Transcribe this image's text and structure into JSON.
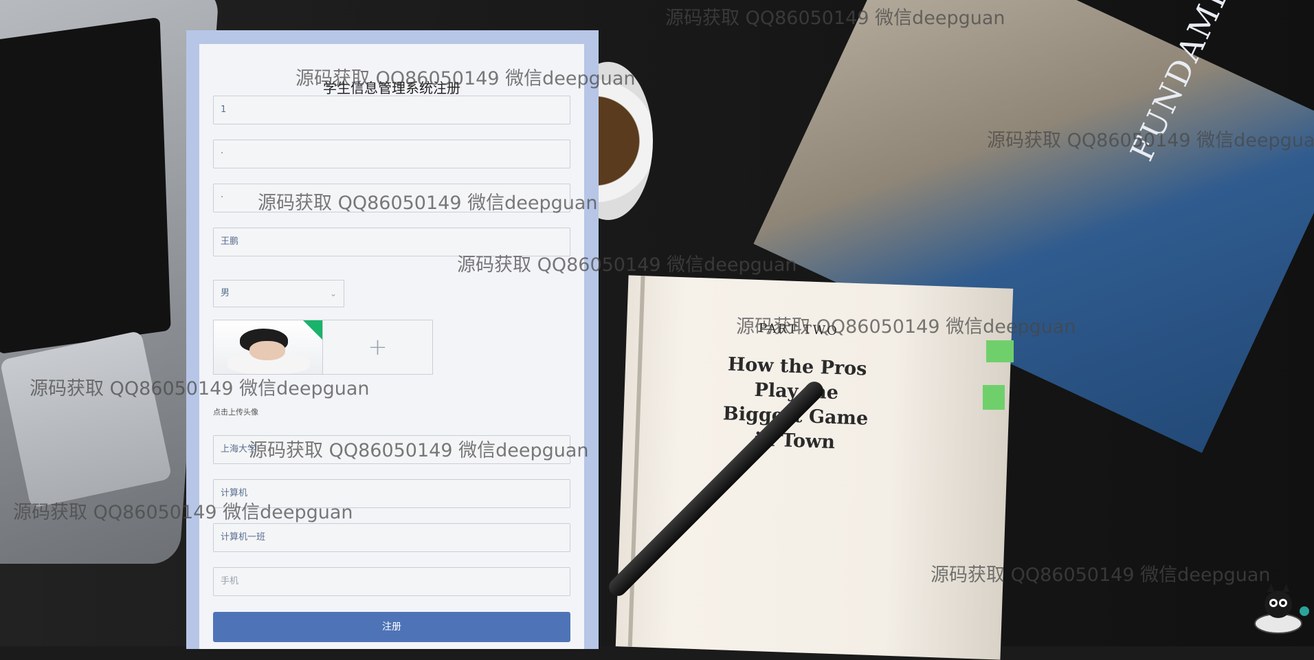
{
  "form": {
    "title": "学生信息管理系统注册",
    "fields": [
      {
        "value": "1"
      },
      {
        "value": "·"
      },
      {
        "value": "·"
      },
      {
        "value": "王鹏"
      }
    ],
    "gender_selected": "男",
    "upload_hint": "点击上传头像",
    "add_icon": "+",
    "school": "上海大学",
    "major": "计算机",
    "class_name": "计算机一班",
    "phone_placeholder": "手机",
    "submit_label": "注册"
  },
  "background": {
    "book_part": "PART TWO",
    "book_lines": [
      "How the Pros",
      "Play the",
      "Biggest Game",
      "in Town"
    ],
    "cover_title": "FUNDAMENTALS OF CORPORATE"
  },
  "watermark": "源码获取 QQ86050149 微信deepguan",
  "colors": {
    "panel_frame": "#b7c6e6",
    "submit_button": "#4e74b7",
    "avatar_badge": "#19b36b"
  }
}
